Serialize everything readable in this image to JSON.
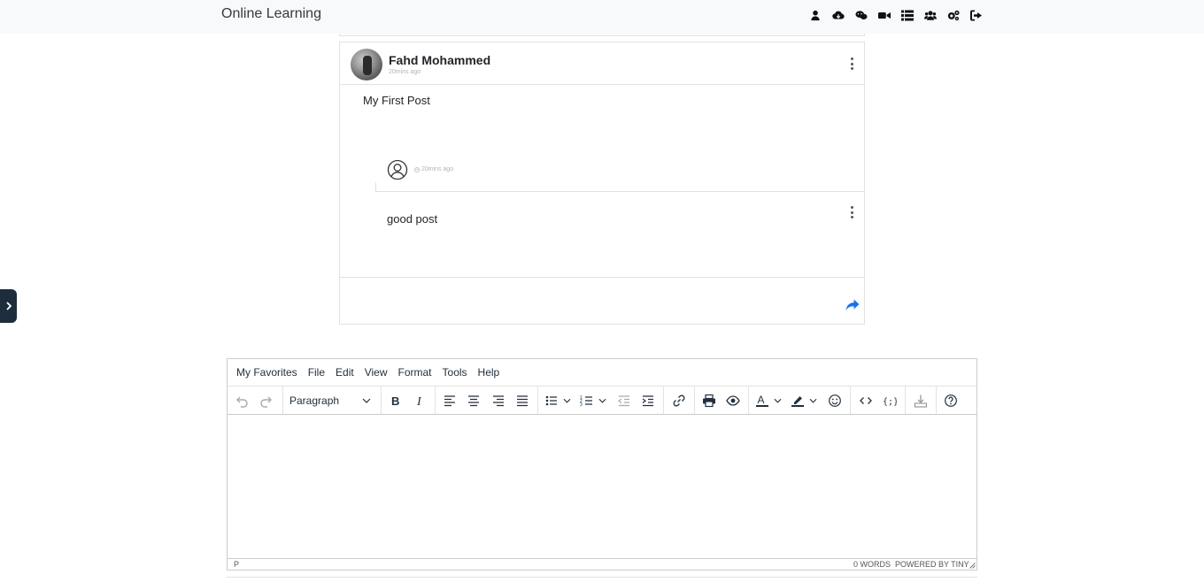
{
  "navbar": {
    "brand": "Online Learning",
    "icons": [
      "user-icon",
      "cloud-download-icon",
      "chat-icon",
      "video-icon",
      "list-icon",
      "users-icon",
      "settings-icon",
      "logout-icon"
    ]
  },
  "post": {
    "author": "Fahd Mohammed",
    "time": "20mins ago",
    "body": "My First Post",
    "comment": {
      "time": "20mins ago",
      "text": "good post"
    }
  },
  "editor": {
    "menu": [
      "My Favorites",
      "File",
      "Edit",
      "View",
      "Format",
      "Tools",
      "Help"
    ],
    "block_format": "Paragraph",
    "status_path": "P",
    "word_count": "0 WORDS",
    "powered_by": "POWERED BY TINY"
  },
  "colors": {
    "navbar_bg": "#f8f9fa",
    "side_toggle": "#1e2d3d",
    "share_accent": "#1a73e8"
  }
}
